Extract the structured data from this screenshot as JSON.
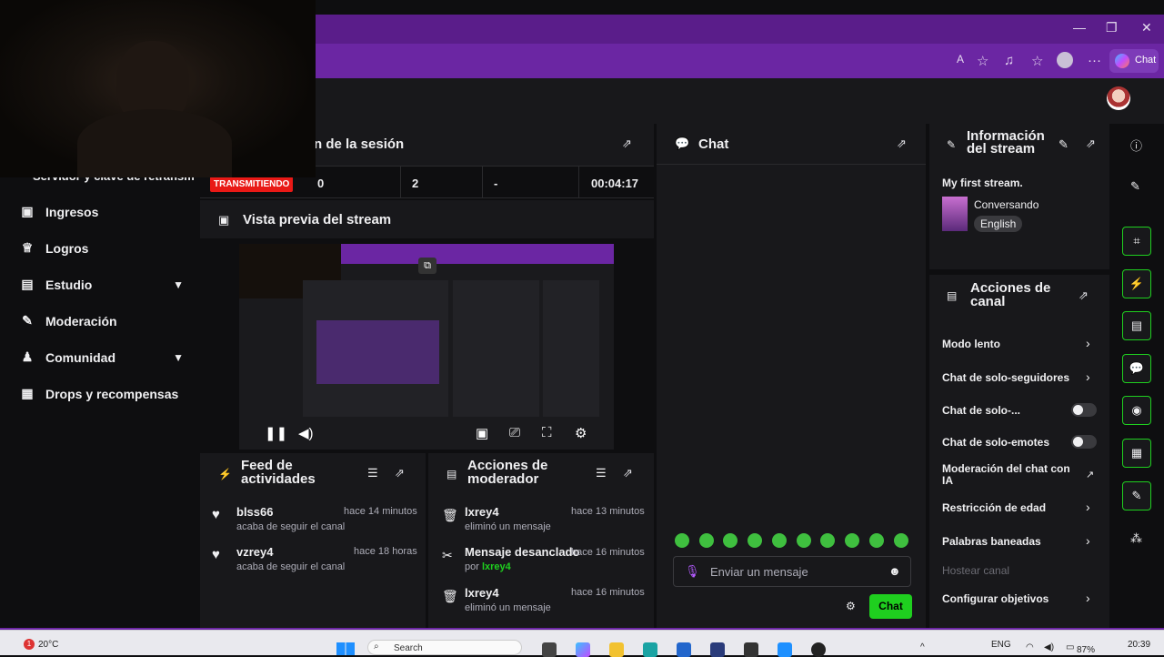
{
  "browser": {
    "copilot_label": "Chat",
    "window_controls": [
      "minimize",
      "restore",
      "close"
    ]
  },
  "session": {
    "title": "n de la sesión",
    "live_badge": "TRANSMITIENDO",
    "viewers": "0",
    "followers": "2",
    "subs": "-",
    "uptime": "00:04:17"
  },
  "sidebar": {
    "partial_item": "Servidor y clave de retransm",
    "items": [
      {
        "label": "Ingresos",
        "icon": "money-icon"
      },
      {
        "label": "Logros",
        "icon": "trophy-icon"
      },
      {
        "label": "Estudio",
        "icon": "studio-icon",
        "expandable": true
      },
      {
        "label": "Moderación",
        "icon": "wrench-icon"
      },
      {
        "label": "Comunidad",
        "icon": "people-icon",
        "expandable": true
      },
      {
        "label": "Drops y recompensas",
        "icon": "gift-icon"
      }
    ]
  },
  "preview": {
    "title": "Vista previa del stream"
  },
  "feed": {
    "title": "Feed de actividades",
    "items": [
      {
        "name": "blss66",
        "desc": "acaba de seguir el canal",
        "time": "hace 14 minutos"
      },
      {
        "name": "vzrey4",
        "desc": "acaba de seguir el canal",
        "time": "hace 18 horas"
      }
    ]
  },
  "mod_actions": {
    "title": "Acciones de moderador",
    "items": [
      {
        "name": "lxrey4",
        "desc": "eliminó un mensaje",
        "time": "hace 13 minutos"
      },
      {
        "name": "Mensaje desanclado",
        "desc_prefix": "por",
        "desc_user": "lxrey4",
        "time": "hace 16 minutos"
      },
      {
        "name": "lxrey4",
        "desc": "eliminó un mensaje",
        "time": "hace 16 minutos"
      }
    ]
  },
  "chat": {
    "title": "Chat",
    "placeholder": "Enviar un mensaje",
    "send_label": "Chat"
  },
  "stream_info": {
    "title": "Información del stream",
    "stream_title": "My first stream.",
    "category": "Conversando",
    "language": "English"
  },
  "channel_actions": {
    "title": "Acciones de canal",
    "items": [
      {
        "label": "Modo lento",
        "control": "chevron"
      },
      {
        "label": "Chat de solo-seguidores",
        "control": "chevron"
      },
      {
        "label": "Chat de solo-...",
        "control": "toggle"
      },
      {
        "label": "Chat de solo-emotes",
        "control": "toggle"
      },
      {
        "label": "Moderación del chat con IA",
        "control": "external"
      },
      {
        "label": "Restricción de edad",
        "control": "chevron"
      },
      {
        "label": "Palabras baneadas",
        "control": "chevron"
      },
      {
        "label": "Hostear canal",
        "control": "none",
        "disabled": true
      },
      {
        "label": "Configurar objetivos",
        "control": "chevron"
      }
    ]
  },
  "taskbar": {
    "weather_temp": "20°C",
    "search_label": "Search",
    "lang": "ENG",
    "battery": "87%",
    "time": "20:39",
    "notification_count": "1"
  }
}
